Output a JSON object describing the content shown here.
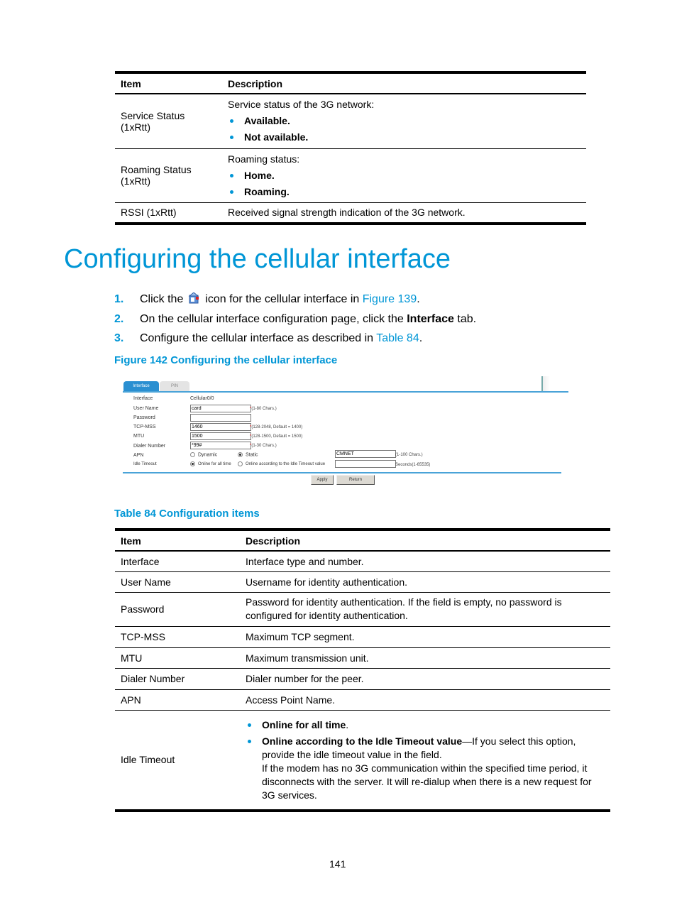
{
  "status_table": {
    "headers": [
      "Item",
      "Description"
    ],
    "rows": [
      {
        "item": "Service Status (1xRtt)",
        "lead": "Service status of the 3G network:",
        "bullets": [
          "Available.",
          "Not available."
        ]
      },
      {
        "item": "Roaming Status (1xRtt)",
        "lead": "Roaming status:",
        "bullets": [
          "Home.",
          "Roaming."
        ]
      },
      {
        "item": "RSSI (1xRtt)",
        "description": "Received signal strength indication of the 3G network."
      }
    ]
  },
  "section": {
    "title": "Configuring the cellular interface",
    "steps": [
      {
        "num": "1.",
        "pre": "Click the",
        "icon": "config-icon",
        "post": "icon for the cellular interface in",
        "link": "Figure 139",
        "end": "."
      },
      {
        "num": "2.",
        "pre": "On the cellular interface configuration page, click the",
        "bold": "Interface",
        "post": "tab."
      },
      {
        "num": "3.",
        "pre": "Configure the cellular interface as described in",
        "link": "Table 84",
        "end": "."
      }
    ]
  },
  "figure": {
    "caption": "Figure 142 Configuring the cellular interface",
    "tabs": [
      "Interface",
      "PIN"
    ],
    "fields": {
      "interface": {
        "label": "Interface",
        "value": "Cellular0/0"
      },
      "user_name": {
        "label": "User Name",
        "value": "card",
        "hint": "(1-80 Chars.)"
      },
      "password": {
        "label": "Password",
        "value": ""
      },
      "tcp_mss": {
        "label": "TCP-MSS",
        "value": "1460",
        "hint": "(128-2048, Default = 1400)"
      },
      "mtu": {
        "label": "MTU",
        "value": "1500",
        "hint": "(128-1500, Default = 1500)"
      },
      "dialer_number": {
        "label": "Dialer Number",
        "value": "*99#",
        "hint": "(1-30 Chars.)"
      },
      "apn": {
        "label": "APN",
        "options": [
          "Dynamic",
          "Static"
        ],
        "selected": "Static",
        "value": "CMNET",
        "hint": "(1-100 Chars.)"
      },
      "idle_timeout": {
        "label": "Idle Timeout",
        "options": [
          "Online for all time",
          "Online according to the Idle Timeout value"
        ],
        "selected": "Online for all time",
        "value": "",
        "hint": "Seconds(1-65535)"
      }
    },
    "required_mark": "*",
    "buttons": {
      "apply": "Apply",
      "return": "Return"
    }
  },
  "config_table": {
    "caption": "Table 84 Configuration items",
    "headers": [
      "Item",
      "Description"
    ],
    "rows": [
      {
        "item": "Interface",
        "description": "Interface type and number."
      },
      {
        "item": "User Name",
        "description": "Username for identity authentication."
      },
      {
        "item": "Password",
        "description": "Password for identity authentication. If the field is empty, no password is configured for identity authentication."
      },
      {
        "item": "TCP-MSS",
        "description": "Maximum TCP segment."
      },
      {
        "item": "MTU",
        "description": "Maximum transmission unit."
      },
      {
        "item": "Dialer Number",
        "description": "Dialer number for the peer."
      },
      {
        "item": "APN",
        "description": "Access Point Name."
      },
      {
        "item": "Idle Timeout",
        "bullet1_bold": "Online for all time",
        "bullet1_end": ".",
        "bullet2_bold": "Online according to the Idle Timeout value",
        "bullet2_rest": "—If you select this option, provide the idle timeout value in the field.",
        "bullet2_extra": "If the modem has no 3G communication within the specified time period, it disconnects with the server. It will re-dialup when there is a new request for 3G services."
      }
    ]
  },
  "page_number": "141"
}
